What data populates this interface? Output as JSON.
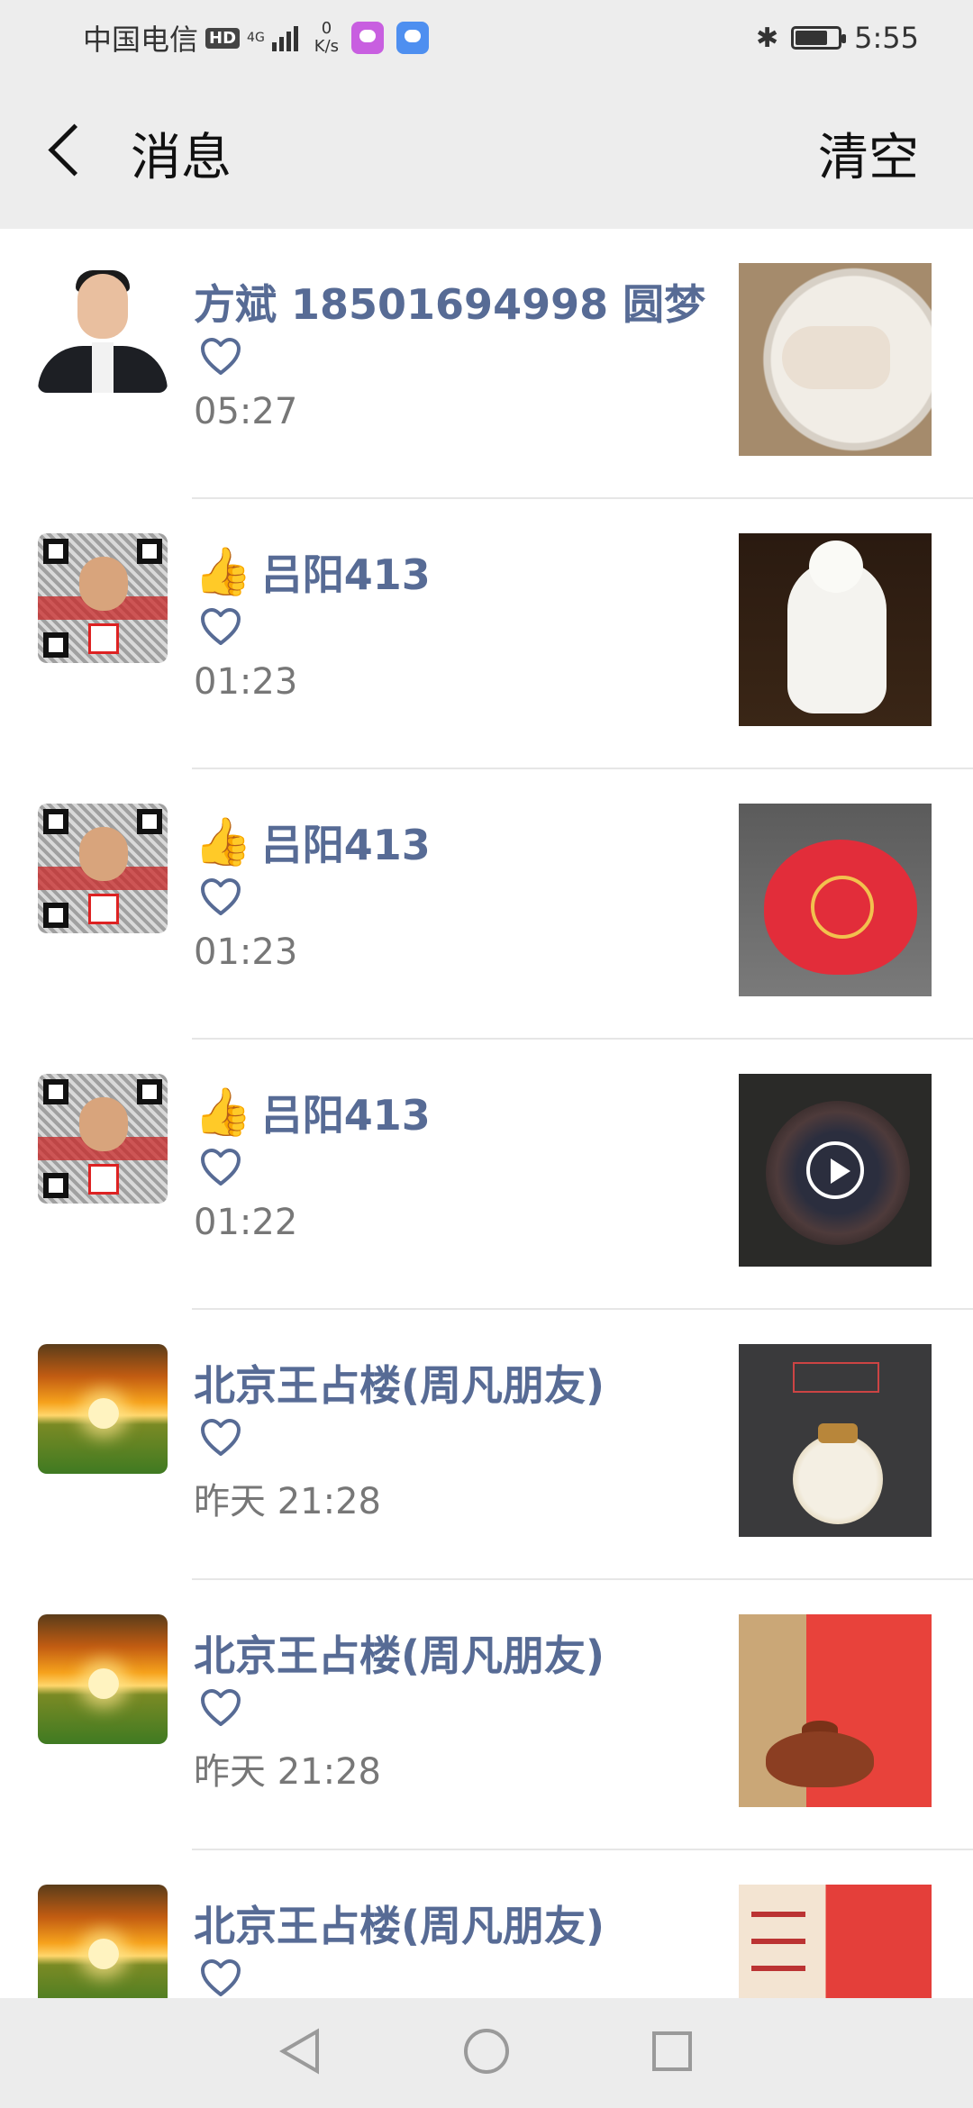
{
  "status_bar": {
    "carrier": "中国电信",
    "hd_label": "HD",
    "network_type": "4G",
    "speed_value": "0",
    "speed_unit": "K/s",
    "time": "5:55"
  },
  "header": {
    "title": "消息",
    "clear_label": "清空"
  },
  "messages": [
    {
      "name": "方斌  18501694998 圆梦",
      "time": "05:27",
      "avatar": "person-avatar",
      "thumbnail": "porcelain-plate-cat",
      "has_thumb_emoji": false
    },
    {
      "name": "吕阳413",
      "time": "01:23",
      "avatar": "qr-code-avatar",
      "thumbnail": "white-buddha-statue",
      "has_thumb_emoji": true
    },
    {
      "name": "吕阳413",
      "time": "01:23",
      "avatar": "qr-code-avatar",
      "thumbnail": "red-tea-cup",
      "has_thumb_emoji": true
    },
    {
      "name": "吕阳413",
      "time": "01:22",
      "avatar": "qr-code-avatar",
      "thumbnail": "dark-glaze-bowl-video",
      "has_thumb_emoji": true
    },
    {
      "name": "北京王占楼(周凡朋友)",
      "time": "昨天 21:28",
      "avatar": "sunset-avatar",
      "thumbnail": "enamel-jar",
      "has_thumb_emoji": false
    },
    {
      "name": "北京王占楼(周凡朋友)",
      "time": "昨天 21:28",
      "avatar": "sunset-avatar",
      "thumbnail": "clay-teapot",
      "has_thumb_emoji": false
    },
    {
      "name": "北京王占楼(周凡朋友)",
      "time": "",
      "avatar": "sunset-avatar",
      "thumbnail": "certificate-red-bag",
      "has_thumb_emoji": false
    }
  ],
  "icons": {
    "like": "heart-outline-icon",
    "thumb": "👍",
    "back": "chevron-left-icon",
    "bluetooth": "bluetooth-icon",
    "battery": "battery-icon"
  },
  "colors": {
    "name_link": "#576b95",
    "header_bg": "#ededed",
    "time_text": "#777777"
  },
  "battery_level": 0.7
}
